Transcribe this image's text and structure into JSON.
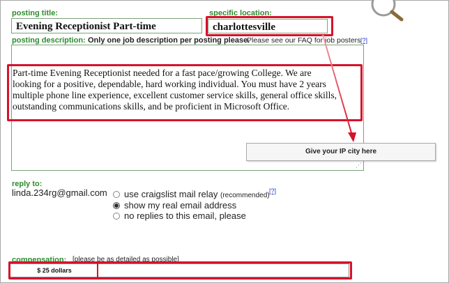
{
  "posting_title": {
    "label": "posting title:",
    "value": "Evening Receptionist Part-time"
  },
  "specific_location": {
    "label": "specific location:",
    "value": "charlottesville"
  },
  "posting_description": {
    "label": "posting description:",
    "note_bold": "Only one job description per posting please.",
    "note_regular": "Please see our FAQ for job posters",
    "help_link": "[?]",
    "text_lines": [
      "Part-time Evening Receptionist needed for a fast pace/growing College. We are",
      "looking for a positive, dependable, hard working individual. You must have 2 years",
      "multiple phone line experience, excellent customer service skills, general office skills,",
      "outstanding communications skills, and be proficient in Microsoft Office."
    ]
  },
  "callout": {
    "text": "Give your IP city here"
  },
  "reply_to": {
    "label": "reply to:",
    "email": "linda.234rg@gmail.com",
    "options": [
      {
        "label": "use craigslist mail relay",
        "suffix": "(recommended)",
        "help": "[?]",
        "checked": false
      },
      {
        "label": "show my real email address",
        "checked": true
      },
      {
        "label": "no replies to this email, please",
        "checked": false
      }
    ]
  },
  "compensation": {
    "label": "compensation:",
    "hint": "[please be as detailed as possible]",
    "value": "$ 25 dollars"
  },
  "colors": {
    "label_green": "#2e8b2e",
    "highlight_red": "#d6122b",
    "link_blue": "#2233cc"
  },
  "icons": [
    "magnifier-icon",
    "arrow-annotation"
  ]
}
